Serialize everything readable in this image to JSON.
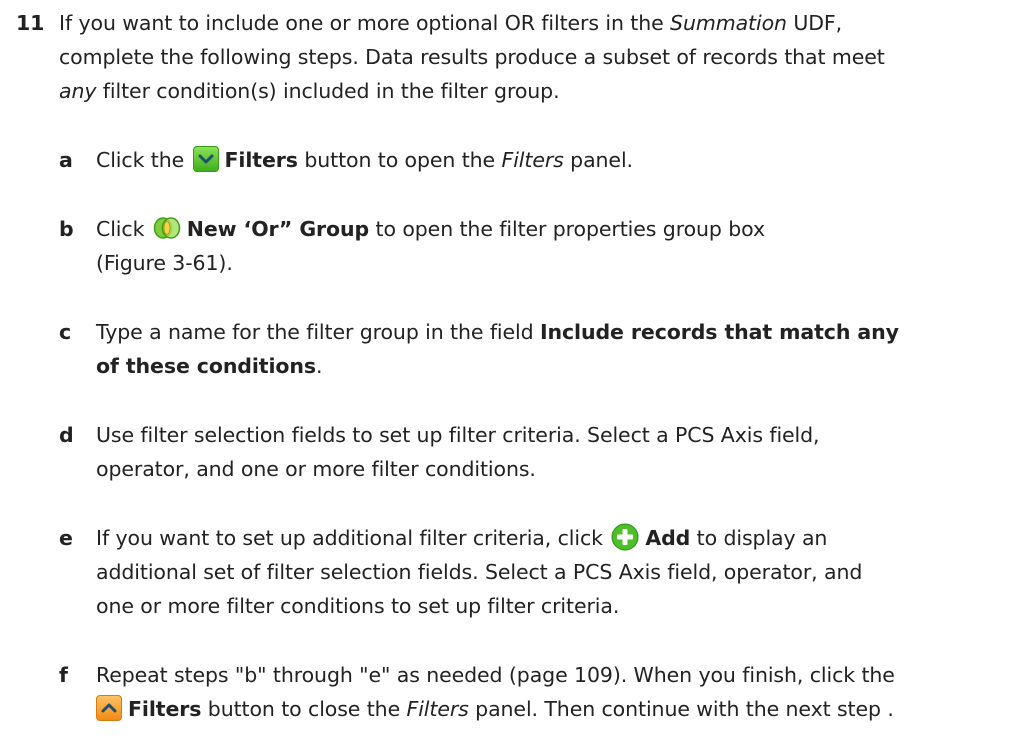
{
  "step": {
    "number": "11",
    "line1": {
      "pre": "If you want to include one or more optional OR filters in the ",
      "em": "Summation",
      "post": " UDF,"
    },
    "line2": "complete the following steps. Data results produce a subset of records that meet",
    "line3": {
      "em": "any",
      "post": " filter condition(s) included in the filter group."
    }
  },
  "substeps": {
    "a": {
      "letter": "a",
      "pre": "Click the ",
      "icon": "green-chevron-down-icon",
      "bold": "Filters",
      "mid": " button to open the ",
      "em": "Filters",
      "post": " panel."
    },
    "b": {
      "letter": "b",
      "pre": "Click ",
      "icon": "or-group-icon",
      "bold": "New ‘Or” Group",
      "post": " to open the filter properties group box",
      "line2": "(Figure 3-61)."
    },
    "c": {
      "letter": "c",
      "pre": "Type a name for the filter group in the field ",
      "bold1": "Include records that match any",
      "bold2": "of these conditions",
      "post": "."
    },
    "d": {
      "letter": "d",
      "line1": "Use filter selection fields to set up filter criteria. Select a PCS Axis field,",
      "line2": "operator, and one or more filter conditions."
    },
    "e": {
      "letter": "e",
      "pre": "If you want to set up additional filter criteria, click ",
      "icon": "add-icon",
      "bold": "Add",
      "post": " to display an",
      "line2": "additional set of filter selection fields. Select a PCS Axis field, operator, and",
      "line3": "one or more filter conditions to set up filter criteria."
    },
    "f": {
      "letter": "f",
      "line1": "Repeat steps \"b\" through \"e\" as needed (page 109). When you finish, click the",
      "icon": "orange-chevron-up-icon",
      "bold": "Filters",
      "mid": " button to close the ",
      "em": "Filters",
      "post": " panel. Then continue with the next step ."
    }
  },
  "colors": {
    "text": "#222222",
    "green_button": "#4fbf26",
    "orange_button": "#f5a030",
    "add_icon_green": "#4cbf2a"
  }
}
